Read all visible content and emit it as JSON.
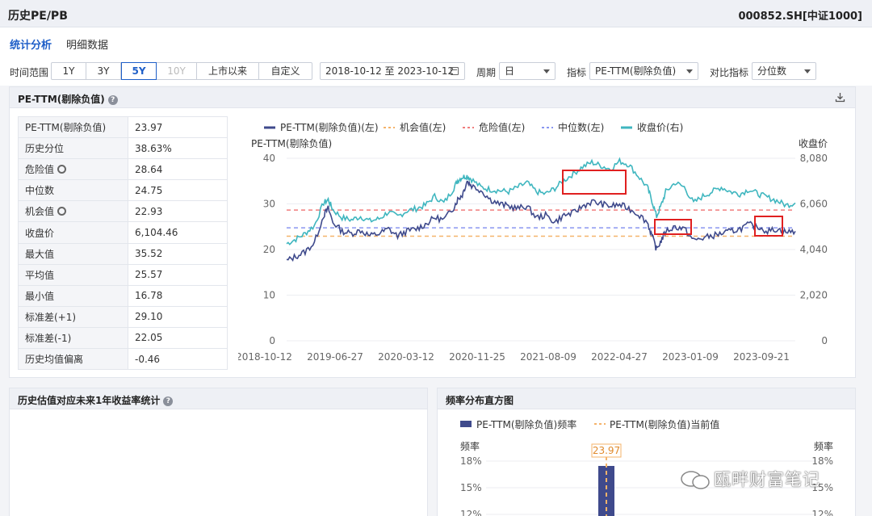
{
  "header": {
    "title": "历史PE/PB",
    "code": "000852.SH[中证1000]"
  },
  "tabs": [
    {
      "label": "统计分析",
      "active": true
    },
    {
      "label": "明细数据",
      "active": false
    }
  ],
  "controls": {
    "time_label": "时间范围",
    "ranges": [
      {
        "label": "1Y",
        "state": "normal"
      },
      {
        "label": "3Y",
        "state": "normal"
      },
      {
        "label": "5Y",
        "state": "selected"
      },
      {
        "label": "10Y",
        "state": "disabled"
      },
      {
        "label": "上市以来",
        "state": "normal"
      },
      {
        "label": "自定义",
        "state": "normal"
      }
    ],
    "date_range": "2018-10-12 至 2023-10-12",
    "period_label": "周期",
    "period_value": "日",
    "indicator_label": "指标",
    "indicator_value": "PE-TTM(剔除负值)",
    "compare_label": "对比指标",
    "compare_value": "分位数"
  },
  "main_panel": {
    "title": "PE-TTM(剔除负值)",
    "stats": [
      {
        "key": "PE-TTM(剔除负值)",
        "value": "23.97",
        "gear": false
      },
      {
        "key": "历史分位",
        "value": "38.63%",
        "gear": false
      },
      {
        "key": "危险值",
        "value": "28.64",
        "gear": true
      },
      {
        "key": "中位数",
        "value": "24.75",
        "gear": false
      },
      {
        "key": "机会值",
        "value": "22.93",
        "gear": true
      },
      {
        "key": "收盘价",
        "value": "6,104.46",
        "gear": false
      },
      {
        "key": "最大值",
        "value": "35.52",
        "gear": false
      },
      {
        "key": "平均值",
        "value": "25.57",
        "gear": false
      },
      {
        "key": "最小值",
        "value": "16.78",
        "gear": false
      },
      {
        "key": "标准差(+1)",
        "value": "29.10",
        "gear": false
      },
      {
        "key": "标准差(-1)",
        "value": "22.05",
        "gear": false
      },
      {
        "key": "历史均值偏离",
        "value": "-0.46",
        "gear": false
      }
    ]
  },
  "chart_data": {
    "type": "line",
    "legend": [
      "PE-TTM(剔除负值)(左)",
      "机会值(左)",
      "危险值(左)",
      "中位数(左)",
      "收盘价(右)"
    ],
    "ylabel_left": "PE-TTM(剔除负值)",
    "ylabel_right": "收盘价",
    "y_left_ticks": [
      "0",
      "10",
      "20",
      "30",
      "40"
    ],
    "y_right_ticks": [
      "0",
      "2,020",
      "4,040",
      "6,060",
      "8,080"
    ],
    "ylim_left": [
      0,
      40
    ],
    "ylim_right": [
      0,
      8080
    ],
    "x_ticks": [
      "2018-10-12",
      "2019-06-27",
      "2020-03-12",
      "2020-11-25",
      "2021-08-09",
      "2022-04-27",
      "2023-01-09",
      "2023-09-21"
    ],
    "reference_lines": {
      "danger": 28.64,
      "median": 24.75,
      "opportunity": 22.93
    },
    "pe_series": [
      [
        0,
        17.5
      ],
      [
        0.02,
        18.5
      ],
      [
        0.04,
        19.5
      ],
      [
        0.06,
        21.5
      ],
      [
        0.08,
        27.5
      ],
      [
        0.09,
        29
      ],
      [
        0.1,
        26
      ],
      [
        0.12,
        24
      ],
      [
        0.14,
        23.5
      ],
      [
        0.16,
        24.2
      ],
      [
        0.18,
        23
      ],
      [
        0.2,
        23.5
      ],
      [
        0.22,
        24.5
      ],
      [
        0.24,
        23
      ],
      [
        0.26,
        24
      ],
      [
        0.28,
        24.5
      ],
      [
        0.3,
        25.5
      ],
      [
        0.32,
        27
      ],
      [
        0.34,
        26.5
      ],
      [
        0.36,
        29
      ],
      [
        0.37,
        31
      ],
      [
        0.38,
        32
      ],
      [
        0.39,
        35
      ],
      [
        0.4,
        34
      ],
      [
        0.42,
        33
      ],
      [
        0.44,
        31
      ],
      [
        0.46,
        30
      ],
      [
        0.48,
        29.5
      ],
      [
        0.5,
        29
      ],
      [
        0.52,
        29.5
      ],
      [
        0.54,
        27
      ],
      [
        0.56,
        27.5
      ],
      [
        0.58,
        26
      ],
      [
        0.6,
        27.5
      ],
      [
        0.62,
        28
      ],
      [
        0.64,
        29.5
      ],
      [
        0.66,
        30.5
      ],
      [
        0.68,
        30
      ],
      [
        0.7,
        29.5
      ],
      [
        0.72,
        29.8
      ],
      [
        0.74,
        29
      ],
      [
        0.76,
        27.8
      ],
      [
        0.78,
        26
      ],
      [
        0.79,
        23
      ],
      [
        0.8,
        20
      ],
      [
        0.81,
        22
      ],
      [
        0.82,
        24
      ],
      [
        0.84,
        25
      ],
      [
        0.86,
        24.5
      ],
      [
        0.88,
        22
      ],
      [
        0.9,
        22.5
      ],
      [
        0.92,
        23
      ],
      [
        0.94,
        23.5
      ],
      [
        0.96,
        24
      ],
      [
        0.98,
        24.5
      ],
      [
        1.0,
        25.5
      ],
      [
        1.02,
        25
      ],
      [
        1.04,
        24
      ],
      [
        1.06,
        24.5
      ],
      [
        1.08,
        23.8
      ],
      [
        1.1,
        24
      ]
    ],
    "close_series": [
      [
        0,
        4300
      ],
      [
        0.02,
        4500
      ],
      [
        0.04,
        4750
      ],
      [
        0.06,
        5100
      ],
      [
        0.08,
        6100
      ],
      [
        0.09,
        6250
      ],
      [
        0.1,
        5800
      ],
      [
        0.12,
        5450
      ],
      [
        0.14,
        5350
      ],
      [
        0.16,
        5500
      ],
      [
        0.18,
        5300
      ],
      [
        0.2,
        5400
      ],
      [
        0.22,
        5700
      ],
      [
        0.24,
        5500
      ],
      [
        0.26,
        5750
      ],
      [
        0.28,
        5850
      ],
      [
        0.3,
        6000
      ],
      [
        0.32,
        6400
      ],
      [
        0.34,
        6100
      ],
      [
        0.36,
        6700
      ],
      [
        0.37,
        7100
      ],
      [
        0.38,
        7250
      ],
      [
        0.39,
        7300
      ],
      [
        0.4,
        7150
      ],
      [
        0.42,
        6800
      ],
      [
        0.44,
        6700
      ],
      [
        0.46,
        6650
      ],
      [
        0.48,
        6600
      ],
      [
        0.5,
        6800
      ],
      [
        0.52,
        7000
      ],
      [
        0.54,
        6600
      ],
      [
        0.56,
        6500
      ],
      [
        0.58,
        6750
      ],
      [
        0.6,
        7100
      ],
      [
        0.62,
        7400
      ],
      [
        0.64,
        7700
      ],
      [
        0.66,
        7900
      ],
      [
        0.68,
        7750
      ],
      [
        0.7,
        7600
      ],
      [
        0.72,
        7950
      ],
      [
        0.74,
        7800
      ],
      [
        0.76,
        7300
      ],
      [
        0.78,
        6800
      ],
      [
        0.79,
        6200
      ],
      [
        0.8,
        5500
      ],
      [
        0.81,
        6000
      ],
      [
        0.82,
        6600
      ],
      [
        0.84,
        7000
      ],
      [
        0.86,
        6800
      ],
      [
        0.88,
        6100
      ],
      [
        0.9,
        6400
      ],
      [
        0.92,
        6600
      ],
      [
        0.94,
        6800
      ],
      [
        0.96,
        6600
      ],
      [
        0.98,
        6500
      ],
      [
        1.0,
        6700
      ],
      [
        1.02,
        6500
      ],
      [
        1.04,
        6350
      ],
      [
        1.06,
        6200
      ],
      [
        1.08,
        6000
      ],
      [
        1.1,
        6100
      ]
    ]
  },
  "bottom_left": {
    "title": "历史估值对应未来1年收益率统计"
  },
  "bottom_right": {
    "title": "频率分布直方图",
    "legend": [
      "PE-TTM(剔除负值)频率",
      "PE-TTM(剔除负值)当前值"
    ],
    "ylabel": "频率",
    "current_value": "23.97",
    "y_ticks": [
      "18%",
      "15%",
      "12%"
    ]
  },
  "watermark": "瓯畔财富笔记",
  "colors": {
    "pe": "#3f4a8c",
    "close": "#3fb6bf",
    "danger": "#f07d7d",
    "median": "#8a96f0",
    "opportunity": "#f5b36a",
    "accent": "#1f5fc8",
    "highlight": "#e02020"
  }
}
